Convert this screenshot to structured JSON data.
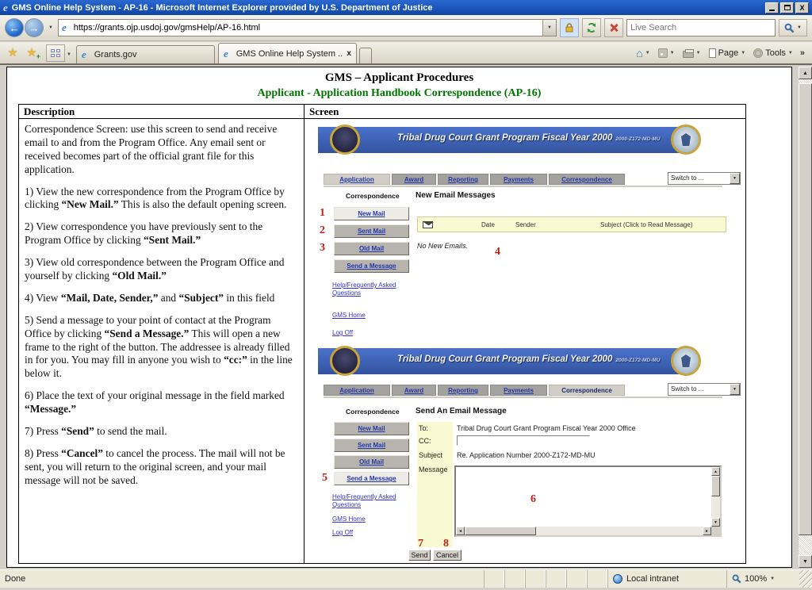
{
  "window": {
    "title": "GMS Online Help System - AP-16 - Microsoft Internet Explorer provided by U.S. Department of Justice"
  },
  "browser": {
    "address_url": "https://grants.ojp.usdoj.gov/gmsHelp/AP-16.html",
    "search_placeholder": "Live Search",
    "tabs": [
      {
        "label": "Grants.gov"
      },
      {
        "label": "GMS Online Help System ..."
      }
    ],
    "menu": {
      "page": "Page",
      "tools": "Tools",
      "more": "»"
    },
    "status": {
      "message": "Done",
      "zone": "Local intranet",
      "zoom": "100%"
    }
  },
  "doc": {
    "title": "GMS – Applicant Procedures",
    "subtitle": "Applicant - Application Handbook Correspondence (AP-16)",
    "columns": {
      "description": "Description",
      "screen": "Screen"
    },
    "paragraphs": [
      "Correspondence Screen: use this screen to send and receive email to and from the Program Office. Any email sent or received becomes part of the official grant file for this application.",
      "1) View the new correspondence from the Program Office by clicking **“New Mail.”** This is also the default opening screen.",
      "2) View correspondence you have previously sent to the Program Office by clicking **“Sent Mail.”**",
      "3) View old correspondence between the Program Office and yourself by clicking **“Old Mail.”**",
      "4) View **“Mail, Date, Sender,”** and **“Subject”** in this field",
      "5) Send a message to your point of contact at the Program Office by clicking **“Send a Message.”**  This will open a new frame to the right of the button. The addressee is already filled in for you.  You may fill in anyone you wish to **“cc:”** in the line below it.",
      "6) Place the text of your original message in the field marked **“Message.”**",
      "7) Press **“Send”** to send the mail.",
      "8) Press **“Cancel”** to cancel the process.  The mail will not be sent, you will return to the original screen, and your mail message will not be saved."
    ]
  },
  "gms": {
    "banner_title": "Tribal Drug Court Grant Program Fiscal Year 2000",
    "banner_code": "2000-Z172-MD-MU",
    "tabs": [
      "Application",
      "Award",
      "Reporting",
      "Payments",
      "Correspondence"
    ],
    "switch_label": "Switch to ...",
    "sidebar_label": "Correspondence",
    "buttons": [
      "New Mail",
      "Sent Mail",
      "Old Mail",
      "Send a Message"
    ],
    "links": [
      "Help/Frequently Asked Questions",
      "GMS Home",
      "Log Off"
    ],
    "callouts": [
      "1",
      "2",
      "3",
      "4",
      "5",
      "6",
      "7",
      "8"
    ],
    "shot1": {
      "heading": "New Email Messages",
      "mail_headers": {
        "date": "Date",
        "sender": "Sender",
        "subject": "Subject (Click to Read Message)"
      },
      "empty": "No New Emails."
    },
    "shot2": {
      "heading": "Send An Email Message",
      "to_label": "To:",
      "to_value": "Tribal Drug Court Grant Program Fiscal Year 2000 Office",
      "cc_label": "CC:",
      "subject_label": "Subject",
      "subject_value": "Re. Application Number 2000-Z172-MD-MU",
      "message_label": "Message",
      "send": "Send",
      "cancel": "Cancel"
    }
  }
}
